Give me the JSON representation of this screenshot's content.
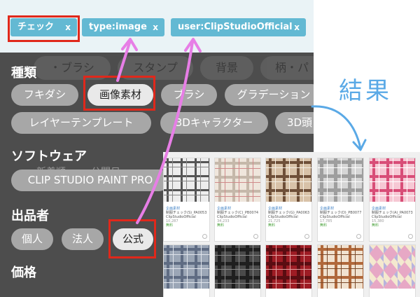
{
  "tags": [
    {
      "label": "チェック",
      "close": "x"
    },
    {
      "label": "type:image",
      "close": "x"
    },
    {
      "label": "user:ClipStudioOfficial",
      "close": "x"
    }
  ],
  "background_tabs": [
    "・ブラシ",
    "スタンプ",
    "背景",
    "柄・パ"
  ],
  "filter": {
    "type_heading": "種類",
    "types_row1": [
      "フキダシ",
      "画像素材",
      "ブラシ",
      "グラデーション"
    ],
    "types_row2": [
      "レイヤーテンプレート",
      "3Dキャラクター",
      "3D頭"
    ],
    "software_heading": "ソフトウェア",
    "sort_hint": [
      "新着順",
      "公開日"
    ],
    "software": [
      "CLIP STUDIO PAINT PRO"
    ],
    "publisher_heading": "出品者",
    "publishers": [
      "個人",
      "法人",
      "公式"
    ],
    "price_heading": "価格"
  },
  "result_label": "結果",
  "results": [
    {
      "category": "企画素材",
      "title": "制服チェック(S)_PA0053",
      "user": "ClipStudioOfficial",
      "downloads": "10,287",
      "status": "無料",
      "pattern": "plaid-white"
    },
    {
      "category": "企画素材",
      "title": "制服チェック(C)_PB0074",
      "user": "ClipStudioOfficial",
      "downloads": "34,233",
      "status": "無料",
      "pattern": "plaid-cream"
    },
    {
      "category": "企画素材",
      "title": "制服チェック(G)_PA0063",
      "user": "ClipStudioOfficial",
      "downloads": "21,725",
      "status": "無料",
      "pattern": "plaid-beige"
    },
    {
      "category": "企画素材",
      "title": "制服チェック(D)_PB0077",
      "user": "ClipStudioOfficial",
      "downloads": "17,785",
      "status": "無料",
      "pattern": "plaid-gray"
    },
    {
      "category": "企画素材",
      "title": "制服チェック(A)_PA0073",
      "user": "ClipStudioOfficial",
      "downloads": "15,380",
      "status": "無料",
      "pattern": "plaid-pink"
    },
    {
      "category": "",
      "title": "",
      "user": "",
      "downloads": "",
      "status": "",
      "pattern": "plaid-blue"
    },
    {
      "category": "",
      "title": "",
      "user": "",
      "downloads": "",
      "status": "",
      "pattern": "plaid-black"
    },
    {
      "category": "",
      "title": "",
      "user": "",
      "downloads": "",
      "status": "",
      "pattern": "plaid-red"
    },
    {
      "category": "",
      "title": "",
      "user": "",
      "downloads": "",
      "status": "",
      "pattern": "plaid-brown"
    },
    {
      "category": "",
      "title": "",
      "user": "",
      "downloads": "",
      "status": "",
      "pattern": "argyle-pastel"
    }
  ],
  "colors": {
    "tag": "#63b9d3",
    "highlight": "#e0281b",
    "arrow_pink": "#e77ee6",
    "arrow_blue": "#5aa9e6",
    "panel": "#4d4d4d"
  }
}
